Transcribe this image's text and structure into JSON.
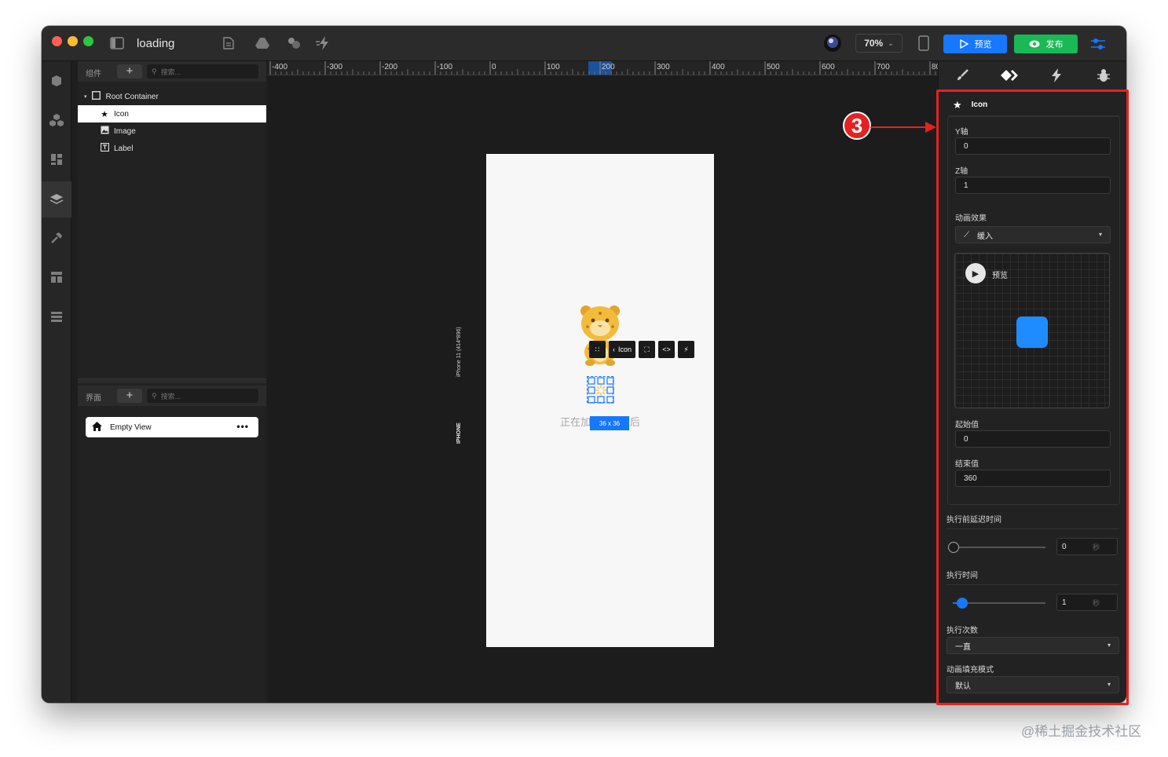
{
  "titlebar": {
    "title": "loading",
    "zoom": "70%",
    "preview_label": "预览",
    "publish_label": "发布"
  },
  "component_panel": {
    "label": "组件",
    "search_placeholder": "搜索...",
    "tree": {
      "root": "Root Container",
      "children": [
        "Icon",
        "Image",
        "Label"
      ]
    }
  },
  "view_panel": {
    "label": "界面",
    "search_placeholder": "搜索...",
    "view_name": "Empty View"
  },
  "ruler": {
    "labels": [
      "-400",
      "-300",
      "-200",
      "-100",
      "0",
      "100",
      "200",
      "300",
      "400",
      "500",
      "600",
      "700",
      "80"
    ]
  },
  "canvas": {
    "device_label": "iPhone 11 (414*896)",
    "device_type": "IPHONE",
    "float_toolbar_label": "Icon",
    "size_badge": "36 x 36",
    "loading_text": "正在加载...请稍后"
  },
  "inspector": {
    "component_name": "Icon",
    "y_label": "Y轴",
    "y_value": "0",
    "z_label": "Z轴",
    "z_value": "1",
    "animation_label": "动画效果",
    "animation_value": "缓入",
    "preview_label": "预览",
    "start_label": "起始值",
    "start_value": "0",
    "end_label": "结束值",
    "end_value": "360",
    "delay_label": "执行前延迟时间",
    "delay_value": "0",
    "delay_unit": "秒",
    "duration_label": "执行时间",
    "duration_value": "1",
    "duration_unit": "秒",
    "count_label": "执行次数",
    "count_value": "一直",
    "fill_label": "动画填充模式",
    "fill_value": "默认"
  },
  "annotation": {
    "number": "3",
    "color": "#e52222"
  },
  "watermark": "@稀土掘金技术社区",
  "colors": {
    "accent_blue": "#1677ff",
    "publish_green": "#19b955"
  }
}
